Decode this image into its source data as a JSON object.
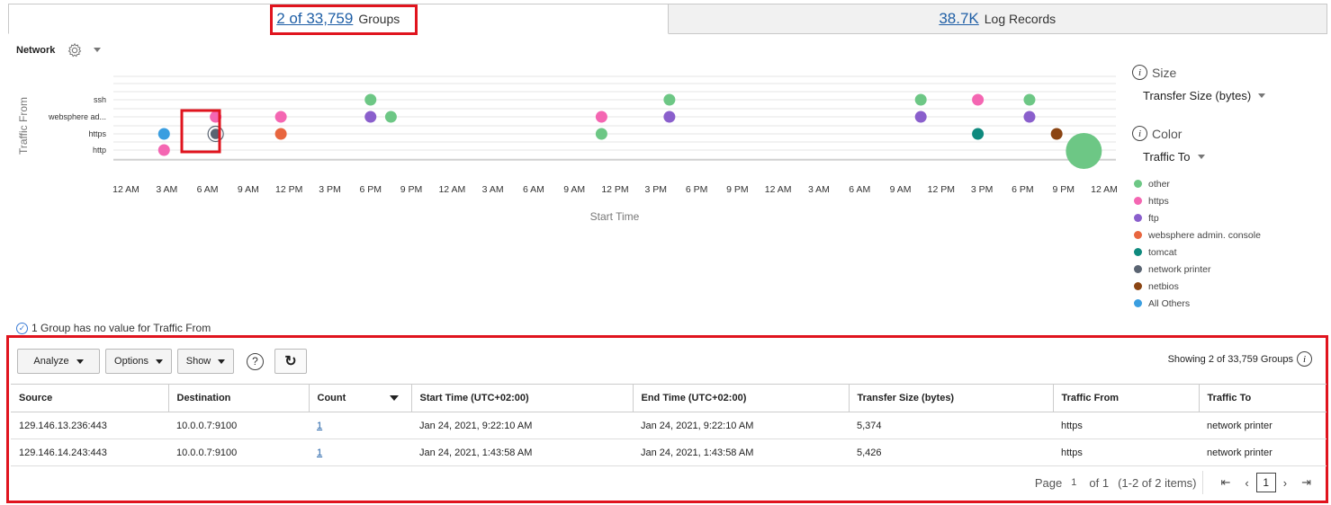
{
  "tabs": [
    {
      "count": "2 of 33,759",
      "label": "Groups"
    },
    {
      "count": "38.7K",
      "label": "Log Records"
    }
  ],
  "chart_panel": {
    "title": "Network"
  },
  "chart_data": {
    "type": "scatter",
    "xlabel": "Start Time",
    "ylabel": "Traffic From",
    "x_ticks": [
      "12 AM",
      "3 AM",
      "6 AM",
      "9 AM",
      "12 PM",
      "3 PM",
      "6 PM",
      "9 PM",
      "12 AM",
      "3 AM",
      "6 AM",
      "9 AM",
      "12 PM",
      "3 PM",
      "6 PM",
      "9 PM",
      "12 AM",
      "3 AM",
      "6 AM",
      "9 AM",
      "12 PM",
      "3 PM",
      "6 PM",
      "9 PM",
      "12 AM"
    ],
    "y_categories": [
      "ssh",
      "websphere ad...",
      "https",
      "http"
    ],
    "legend_position": "right",
    "size_by": "Transfer Size (bytes)",
    "color_by": "Traffic To",
    "series": [
      {
        "name": "other",
        "color": "#6dc785",
        "points": [
          {
            "x_hour": 18,
            "y": "ssh"
          },
          {
            "x_hour": 19.5,
            "y": "websphere ad..."
          },
          {
            "x_hour": 35,
            "y": "https"
          },
          {
            "x_hour": 40,
            "y": "ssh"
          },
          {
            "x_hour": 58.5,
            "y": "ssh"
          },
          {
            "x_hour": 66.5,
            "y": "ssh"
          },
          {
            "x_hour": 70.5,
            "y": "http",
            "large": true
          }
        ]
      },
      {
        "name": "https",
        "color": "#f466b2",
        "points": [
          {
            "x_hour": 2.8,
            "y": "http"
          },
          {
            "x_hour": 6.6,
            "y": "websphere ad..."
          },
          {
            "x_hour": 11.4,
            "y": "websphere ad..."
          },
          {
            "x_hour": 35,
            "y": "websphere ad..."
          },
          {
            "x_hour": 62.7,
            "y": "ssh"
          }
        ]
      },
      {
        "name": "ftp",
        "color": "#8a5fcc",
        "points": [
          {
            "x_hour": 18,
            "y": "websphere ad..."
          },
          {
            "x_hour": 40,
            "y": "websphere ad..."
          },
          {
            "x_hour": 58.5,
            "y": "websphere ad..."
          },
          {
            "x_hour": 66.5,
            "y": "websphere ad..."
          }
        ]
      },
      {
        "name": "websphere admin. console",
        "color": "#e8663f",
        "points": [
          {
            "x_hour": 11.4,
            "y": "https"
          }
        ]
      },
      {
        "name": "tomcat",
        "color": "#0f8a7e",
        "points": [
          {
            "x_hour": 62.7,
            "y": "https"
          }
        ]
      },
      {
        "name": "network printer",
        "color": "#5a6472",
        "points": [
          {
            "x_hour": 6.6,
            "y": "https"
          }
        ]
      },
      {
        "name": "netbios",
        "color": "#8b4513",
        "points": [
          {
            "x_hour": 68.5,
            "y": "https"
          }
        ]
      },
      {
        "name": "All Others",
        "color": "#3a9ee0",
        "points": [
          {
            "x_hour": 2.8,
            "y": "https"
          }
        ]
      }
    ]
  },
  "side_panel": {
    "size_label": "Size",
    "size_value": "Transfer Size (bytes)",
    "color_label": "Color",
    "color_value": "Traffic To",
    "legend": [
      {
        "label": "other",
        "color": "#6dc785"
      },
      {
        "label": "https",
        "color": "#f466b2"
      },
      {
        "label": "ftp",
        "color": "#8a5fcc"
      },
      {
        "label": "websphere admin. console",
        "color": "#e8663f"
      },
      {
        "label": "tomcat",
        "color": "#0f8a7e"
      },
      {
        "label": "network printer",
        "color": "#5a6472"
      },
      {
        "label": "netbios",
        "color": "#8b4513"
      },
      {
        "label": "All Others",
        "color": "#3a9ee0"
      }
    ]
  },
  "no_value_note": "1 Group has no value for Traffic From",
  "toolbar": {
    "analyze": "Analyze",
    "options": "Options",
    "show": "Show",
    "help": "?",
    "refresh_icon": "refresh-icon",
    "showing": "Showing 2 of 33,759 Groups"
  },
  "table": {
    "columns": [
      "Source",
      "Destination",
      "Count",
      "Start Time (UTC+02:00)",
      "End Time (UTC+02:00)",
      "Transfer Size (bytes)",
      "Traffic From",
      "Traffic To"
    ],
    "rows": [
      [
        "129.146.13.236:443",
        "10.0.0.7:9100",
        "1",
        "Jan 24, 2021, 9:22:10 AM",
        "Jan 24, 2021, 9:22:10 AM",
        "5,374",
        "https",
        "network printer"
      ],
      [
        "129.146.14.243:443",
        "10.0.0.7:9100",
        "1",
        "Jan 24, 2021, 1:43:58 AM",
        "Jan 24, 2021, 1:43:58 AM",
        "5,426",
        "https",
        "network printer"
      ]
    ]
  },
  "pager": {
    "page_label": "Page",
    "page_num": "1",
    "of_label": "of 1",
    "items": "(1-2 of 2 items)",
    "current": "1"
  },
  "colors": {
    "accent": "#1f5fa6",
    "highlight": "#e0141e"
  }
}
